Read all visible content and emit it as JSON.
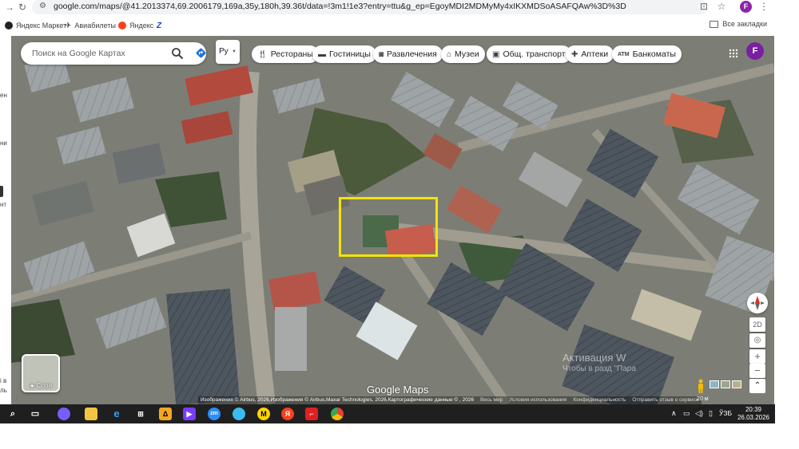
{
  "browser": {
    "url": "google.com/maps/@41.2013374,69.2006179,169a,35y,180h,39.36t/data=!3m1!1e3?entry=ttu&g_ep=EgoyMDI2MDMyMy4xIKXMDSoASAFQAw%3D%3D",
    "profile_initial": "F",
    "bookmarks": [
      "Яндекс Маркет",
      "Авиабилеты",
      "Яндекс"
    ],
    "all_bookmarks": "Все закладки"
  },
  "maps": {
    "search_placeholder": "Поиск на Google Картах",
    "language_button": "Ру",
    "chips": [
      {
        "label": "Рестораны",
        "icon": "fork-knife-icon"
      },
      {
        "label": "Гостиницы",
        "icon": "bed-icon"
      },
      {
        "label": "Развлечения",
        "icon": "camera-icon"
      },
      {
        "label": "Музеи",
        "icon": "museum-icon"
      },
      {
        "label": "Общ. транспорт",
        "icon": "bus-icon"
      },
      {
        "label": "Аптеки",
        "icon": "pharmacy-icon"
      },
      {
        "label": "Банкоматы",
        "icon": "atm-icon"
      }
    ],
    "avatar_initial": "F",
    "layers_label": "Слои",
    "view_mode": "2D",
    "watermark": "Google Maps",
    "activation_title": "Активация W",
    "activation_text": "Чтобы                          в разд\n\"Пара",
    "attribution": [
      "Изображения © Airbus, 2026,Изображения © Airbus,Maxar Technologies, 2026,Картографические данные ©  , 2026",
      "Весь мир",
      "Условия использования",
      "Конфиденциальность",
      "Отправить отзыв о сервисе"
    ],
    "scale": "20 м",
    "left_strip_text": [
      "ен",
      "ни",
      "нт",
      "і в",
      "ль"
    ]
  },
  "taskbar": {
    "language": "ЎЗБ",
    "time": "20:39",
    "date": "26.03.2026"
  },
  "colors": {
    "highlight": "#f5e400",
    "avatar": "#7b1fa2",
    "taskbar": "#1f1f20"
  }
}
